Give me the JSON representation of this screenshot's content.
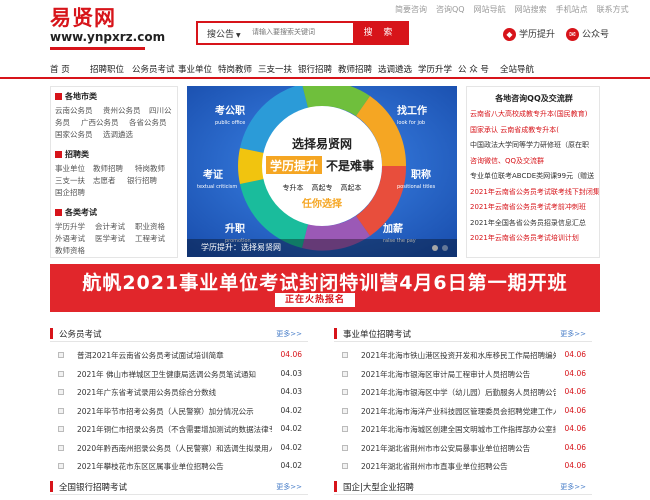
{
  "header": {
    "logo_text": "易贤网",
    "logo_url": "www.ynpxrz.com",
    "top_links": [
      "简要咨询",
      "咨询QQ",
      "网站导航",
      "网站搜索",
      "手机站点",
      "联系方式"
    ],
    "search": {
      "category": "搜公告",
      "placeholder": "请输入要搜索关键词",
      "button": "搜 索"
    },
    "edu_link": "学历提升",
    "wechat_link": "公众号"
  },
  "nav": [
    "首 页",
    "招聘职位",
    "公务员考试",
    "事业单位",
    "特岗教师",
    "三支一扶",
    "银行招聘",
    "教师招聘",
    "选调遴选",
    "学历升学",
    "公 众 号",
    "全站导航"
  ],
  "categories": {
    "local": {
      "heading": "各地市类",
      "items": [
        "云南公务员",
        "贵州公务员",
        "四川公",
        "务员",
        "广西公务员",
        "各省公务员",
        "国家公务员",
        "选调遴选"
      ]
    },
    "recruit": {
      "heading": "招聘类",
      "items": [
        "事业单位",
        "教师招聘",
        "特岗教师",
        "三支一扶",
        "志愿者",
        "银行招聘",
        "国企招聘"
      ]
    },
    "exams": {
      "heading": "各类考试",
      "items": [
        "学历升学",
        "会计考试",
        "职业资格",
        "外语考试",
        "医学考试",
        "工程考试",
        "教师资格"
      ]
    }
  },
  "banner": {
    "ring_labels": [
      "考公职",
      "public office",
      "找工作",
      "look for job",
      "考证",
      "textual criticism",
      "职称",
      "positional titles",
      "升职",
      "promotion",
      "加薪",
      "raise the pay"
    ],
    "headline_1": "选择易贤网",
    "headline_2a": "学历提升",
    "headline_2b": "不是难事",
    "levels": [
      "专升本",
      "高起专",
      "高起本"
    ],
    "tagline": "任你选择",
    "caption": "学历提升：选择易贤网"
  },
  "qq": {
    "title": "各地咨询QQ及交流群",
    "items": [
      {
        "text": "云南省八大高校成教专升本(国民教育)",
        "color": "#d7141a"
      },
      {
        "text": "国家承认 云南省成教专升本(",
        "color": "#d7141a"
      },
      {
        "text": "中国政法大学同等学力研修班（原在职",
        "color": "#333333"
      },
      {
        "text": "咨询微信、QQ及交流群",
        "color": "#d7141a"
      },
      {
        "text": "专业单位联考ABCDE类网课99元（赠送",
        "color": "#333333"
      },
      {
        "text": "2021年云南省公务员考试联考线下封闭集训营",
        "color": "#d7141a"
      },
      {
        "text": "2021年云南省公务员考试考前冲刺班",
        "color": "#d7141a"
      },
      {
        "text": "2021年全国各省公务员招录信息汇总",
        "color": "#333333"
      },
      {
        "text": "2021年云南省公务员考试培训计划",
        "color": "#d7141a"
      }
    ]
  },
  "ad": {
    "headline": "航帆2021事业单位考试封闭特训营4月6日第一期开班",
    "sub": "正在火热报名"
  },
  "panels": {
    "civil": {
      "title": "公务员考试",
      "more": "更多>>",
      "items": [
        {
          "title": "普洱2021年云南省公务员考试面试培训简章",
          "date": "04.06",
          "hot": true
        },
        {
          "title": "2021年 佛山市禅城区卫生健康局选调公务员笔试通知",
          "date": "04.03",
          "hot": false
        },
        {
          "title": "2021年广东省考试录用公务员综合分数线",
          "date": "04.03",
          "hot": false
        },
        {
          "title": "2021年毕节市招考公务员（人民警察）加分情况公示",
          "date": "04.02",
          "hot": false
        },
        {
          "title": "2021年铜仁市招录公务员（不含需要增加测试的数据法律专业生公示",
          "date": "04.02",
          "hot": false
        },
        {
          "title": "2020年黔西南州招录公务员（人民警察）和选调生拟录用人员公示",
          "date": "04.02",
          "hot": false
        },
        {
          "title": "2021年攀枝花市东区区属事业单位招聘公告",
          "date": "04.02",
          "hot": false
        }
      ]
    },
    "public_inst": {
      "title": "事业单位招聘考试",
      "more": "更多>>",
      "items": [
        {
          "title": "2021年北海市铁山港区投资开发和水库移民工作局招聘编外",
          "date": "04.06",
          "hot": true
        },
        {
          "title": "2021年北海市银海区审计局工程审计人员招聘公告",
          "date": "04.06",
          "hot": true
        },
        {
          "title": "2021年北海市银海区中学（幼儿园）后勤服务人员招聘公告",
          "date": "04.06",
          "hot": true
        },
        {
          "title": "2021年北海市海洋产业科技园区管理委员会招聘党建工作人员",
          "date": "04.06",
          "hot": true
        },
        {
          "title": "2021年北海市海城区创建全国文明城市工作指挥部办公室招聘",
          "date": "04.06",
          "hot": true
        },
        {
          "title": "2021年湖北省荆州市市公安局暴事业单位招聘公告",
          "date": "04.06",
          "hot": true
        },
        {
          "title": "2021年湖北省荆州市市直事业单位招聘公告",
          "date": "04.06",
          "hot": true
        }
      ]
    },
    "bank": {
      "title": "全国银行招聘考试",
      "more": "更多>>"
    },
    "soe": {
      "title": "国企|大型企业招聘",
      "more": "更多>>"
    }
  },
  "colors": {
    "brand_red": "#d7141a",
    "banner_blue": "#1e5fc2",
    "more_link": "#4a7fc9"
  }
}
